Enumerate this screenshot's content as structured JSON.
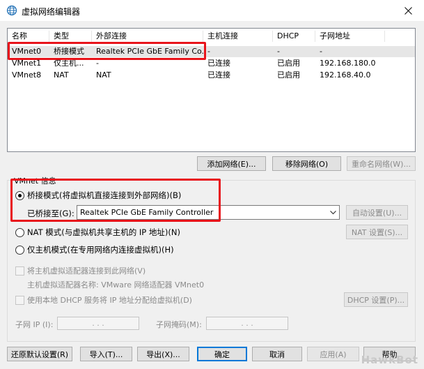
{
  "window": {
    "title": "虚拟网络编辑器"
  },
  "table": {
    "columns": [
      "名称",
      "类型",
      "外部连接",
      "主机连接",
      "DHCP",
      "子网地址"
    ],
    "rows": [
      [
        "VMnet0",
        "桥接模式",
        "Realtek PCIe GbE Family Co...",
        "-",
        "-",
        "-"
      ],
      [
        "VMnet1",
        "仅主机...",
        "-",
        "已连接",
        "已启用",
        "192.168.180.0"
      ],
      [
        "VMnet8",
        "NAT",
        "NAT",
        "已连接",
        "已启用",
        "192.168.40.0"
      ]
    ],
    "selected_row": 0
  },
  "table_buttons": {
    "add": "添加网络(E)...",
    "remove": "移除网络(O)",
    "rename": "重命名网络(W)..."
  },
  "group": {
    "title": "VMnet 信息",
    "bridge_mode": "桥接模式(将虚拟机直接连接到外部网络)(B)",
    "bridged_to_label": "已桥接至(G):",
    "bridged_to_value": "Realtek PCIe GbE Family Controller",
    "auto_settings": "自动设置(U)...",
    "nat_mode": "NAT 模式(与虚拟机共享主机的 IP 地址)(N)",
    "nat_settings": "NAT 设置(S)...",
    "host_only_mode": "仅主机模式(在专用网络内连接虚拟机)(H)",
    "connect_adapter": "将主机虚拟适配器连接到此网络(V)",
    "adapter_name": "主机虚拟适配器名称: VMware 网络适配器 VMnet0",
    "use_dhcp": "使用本地 DHCP 服务将 IP 地址分配给虚拟机(D)",
    "dhcp_settings": "DHCP 设置(P)...",
    "subnet_ip_label": "子网 IP (I):",
    "subnet_mask_label": "子网掩码(M):",
    "ip_dots": ". . ."
  },
  "bottom_buttons": {
    "restore": "还原默认设置(R)",
    "import": "导入(T)...",
    "export": "导出(X)...",
    "ok": "确定",
    "cancel": "取消",
    "apply": "应用(A)",
    "help": "帮助"
  },
  "watermark": "HawkBot",
  "colors": {
    "highlight": "#e8141b",
    "focus": "#0078d7"
  }
}
